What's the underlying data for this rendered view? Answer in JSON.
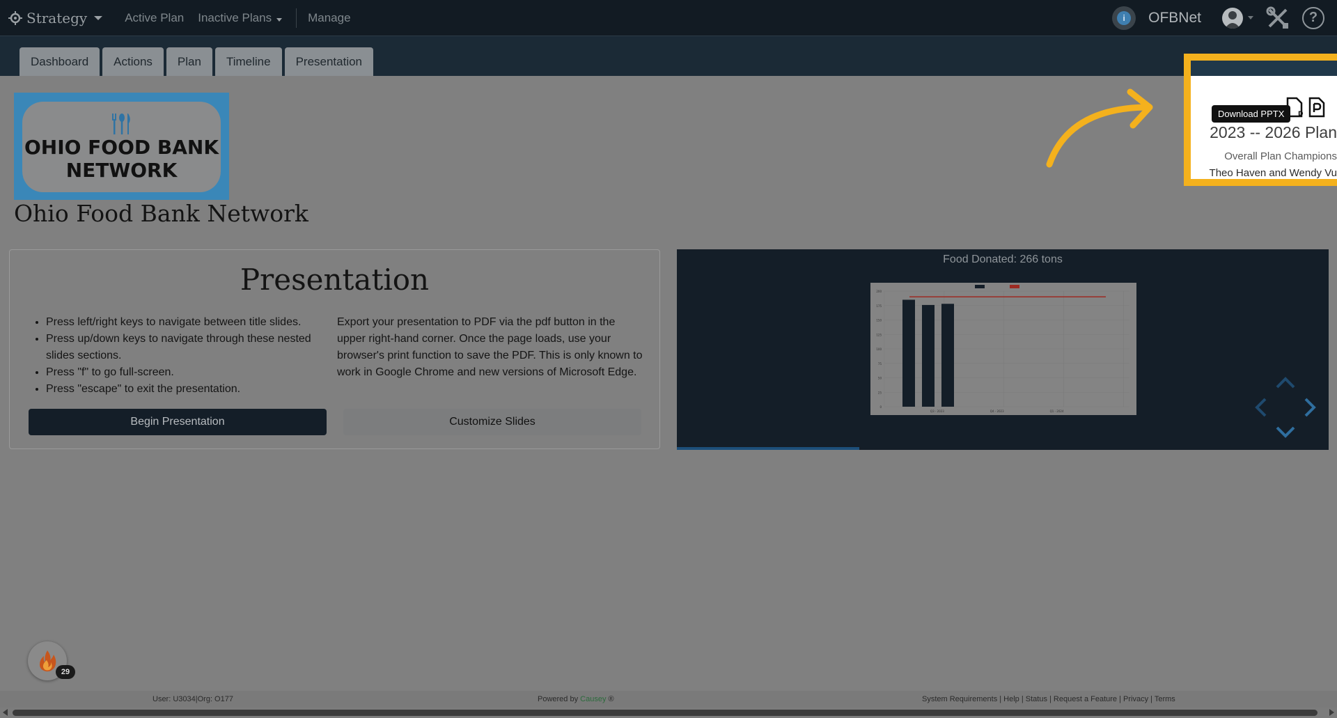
{
  "topbar": {
    "brand": "Strategy",
    "nav": {
      "active_plan": "Active Plan",
      "inactive_plans": "Inactive Plans",
      "manage": "Manage"
    },
    "org_name": "OFBNet"
  },
  "tabs": [
    "Dashboard",
    "Actions",
    "Plan",
    "Timeline",
    "Presentation"
  ],
  "logo": {
    "line1": "OHIO FOOD BANK",
    "line2": "NETWORK"
  },
  "org_title": "Ohio Food Bank Network",
  "presentation": {
    "heading": "Presentation",
    "instructions": [
      "Press left/right keys to navigate between title slides.",
      "Press up/down keys to navigate through these nested slides sections.",
      "Press \"f\" to go full-screen.",
      "Press \"escape\" to exit the presentation."
    ],
    "export_text": "Export your presentation to PDF via the pdf button in the upper right-hand corner. Once the page loads, use your browser's print function to save the PDF. This is only known to work in Google Chrome and new versions of Microsoft Edge.",
    "begin_label": "Begin Presentation",
    "customize_label": "Customize Slides"
  },
  "preview": {
    "title": "Food Donated: 266 tons",
    "progress": 0.28
  },
  "chart_data": {
    "type": "bar",
    "categories": [
      "Q3 - 2023",
      "Q4 - 2023",
      "Q1 - 2024"
    ],
    "values": [
      185,
      176,
      178
    ],
    "target": 190,
    "ylim": [
      0,
      200
    ],
    "yticks": [
      "0",
      "25",
      "50",
      "75",
      "100",
      "125",
      "150",
      "175",
      "200"
    ],
    "legend_position": "top",
    "colors": {
      "bars": "#141e28",
      "target": "#9c2a22",
      "background": "#848484"
    }
  },
  "plan_panel": {
    "tooltip": "Download PPTX",
    "plan_title": "2023 -- 2026 Plan",
    "champions_label": "Overall Plan Champions",
    "champions_names": "Theo Haven and Wendy Vu"
  },
  "streak": {
    "count": "29"
  },
  "footer": {
    "user": "User: U3034|Org: O177",
    "powered_prefix": "Powered by ",
    "powered_brand": "Causey",
    "powered_suffix": " ®",
    "links": "System Requirements | Help | Status | Request a Feature | Privacy | Terms"
  },
  "colors": {
    "accent": "#f4b11d",
    "nav_bg": "#121b23",
    "dark_button": "#141e28"
  }
}
